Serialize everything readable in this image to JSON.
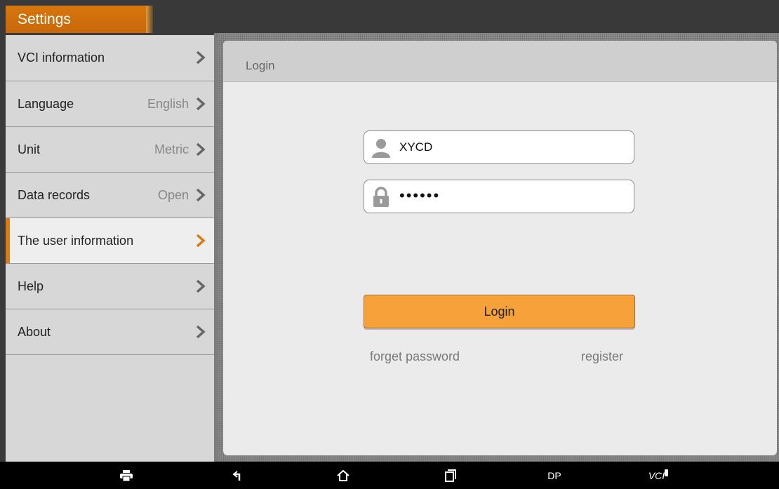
{
  "app": {
    "title": "Settings"
  },
  "sidebar": {
    "items": [
      {
        "label": "VCI information",
        "value": ""
      },
      {
        "label": "Language",
        "value": "English"
      },
      {
        "label": "Unit",
        "value": "Metric"
      },
      {
        "label": "Data records",
        "value": "Open"
      },
      {
        "label": "The user information",
        "value": "",
        "active": true
      },
      {
        "label": "Help",
        "value": ""
      },
      {
        "label": "About",
        "value": ""
      }
    ]
  },
  "login": {
    "header": "Login",
    "username": "XYCD",
    "password_mask": "••••••",
    "login_button": "Login",
    "forget_link": "forget password",
    "register_link": "register"
  },
  "bottombar": {
    "dp_label": "DP",
    "vci_label": "VCI"
  },
  "colors": {
    "accent": "#d97a12",
    "button": "#f7a13a"
  }
}
